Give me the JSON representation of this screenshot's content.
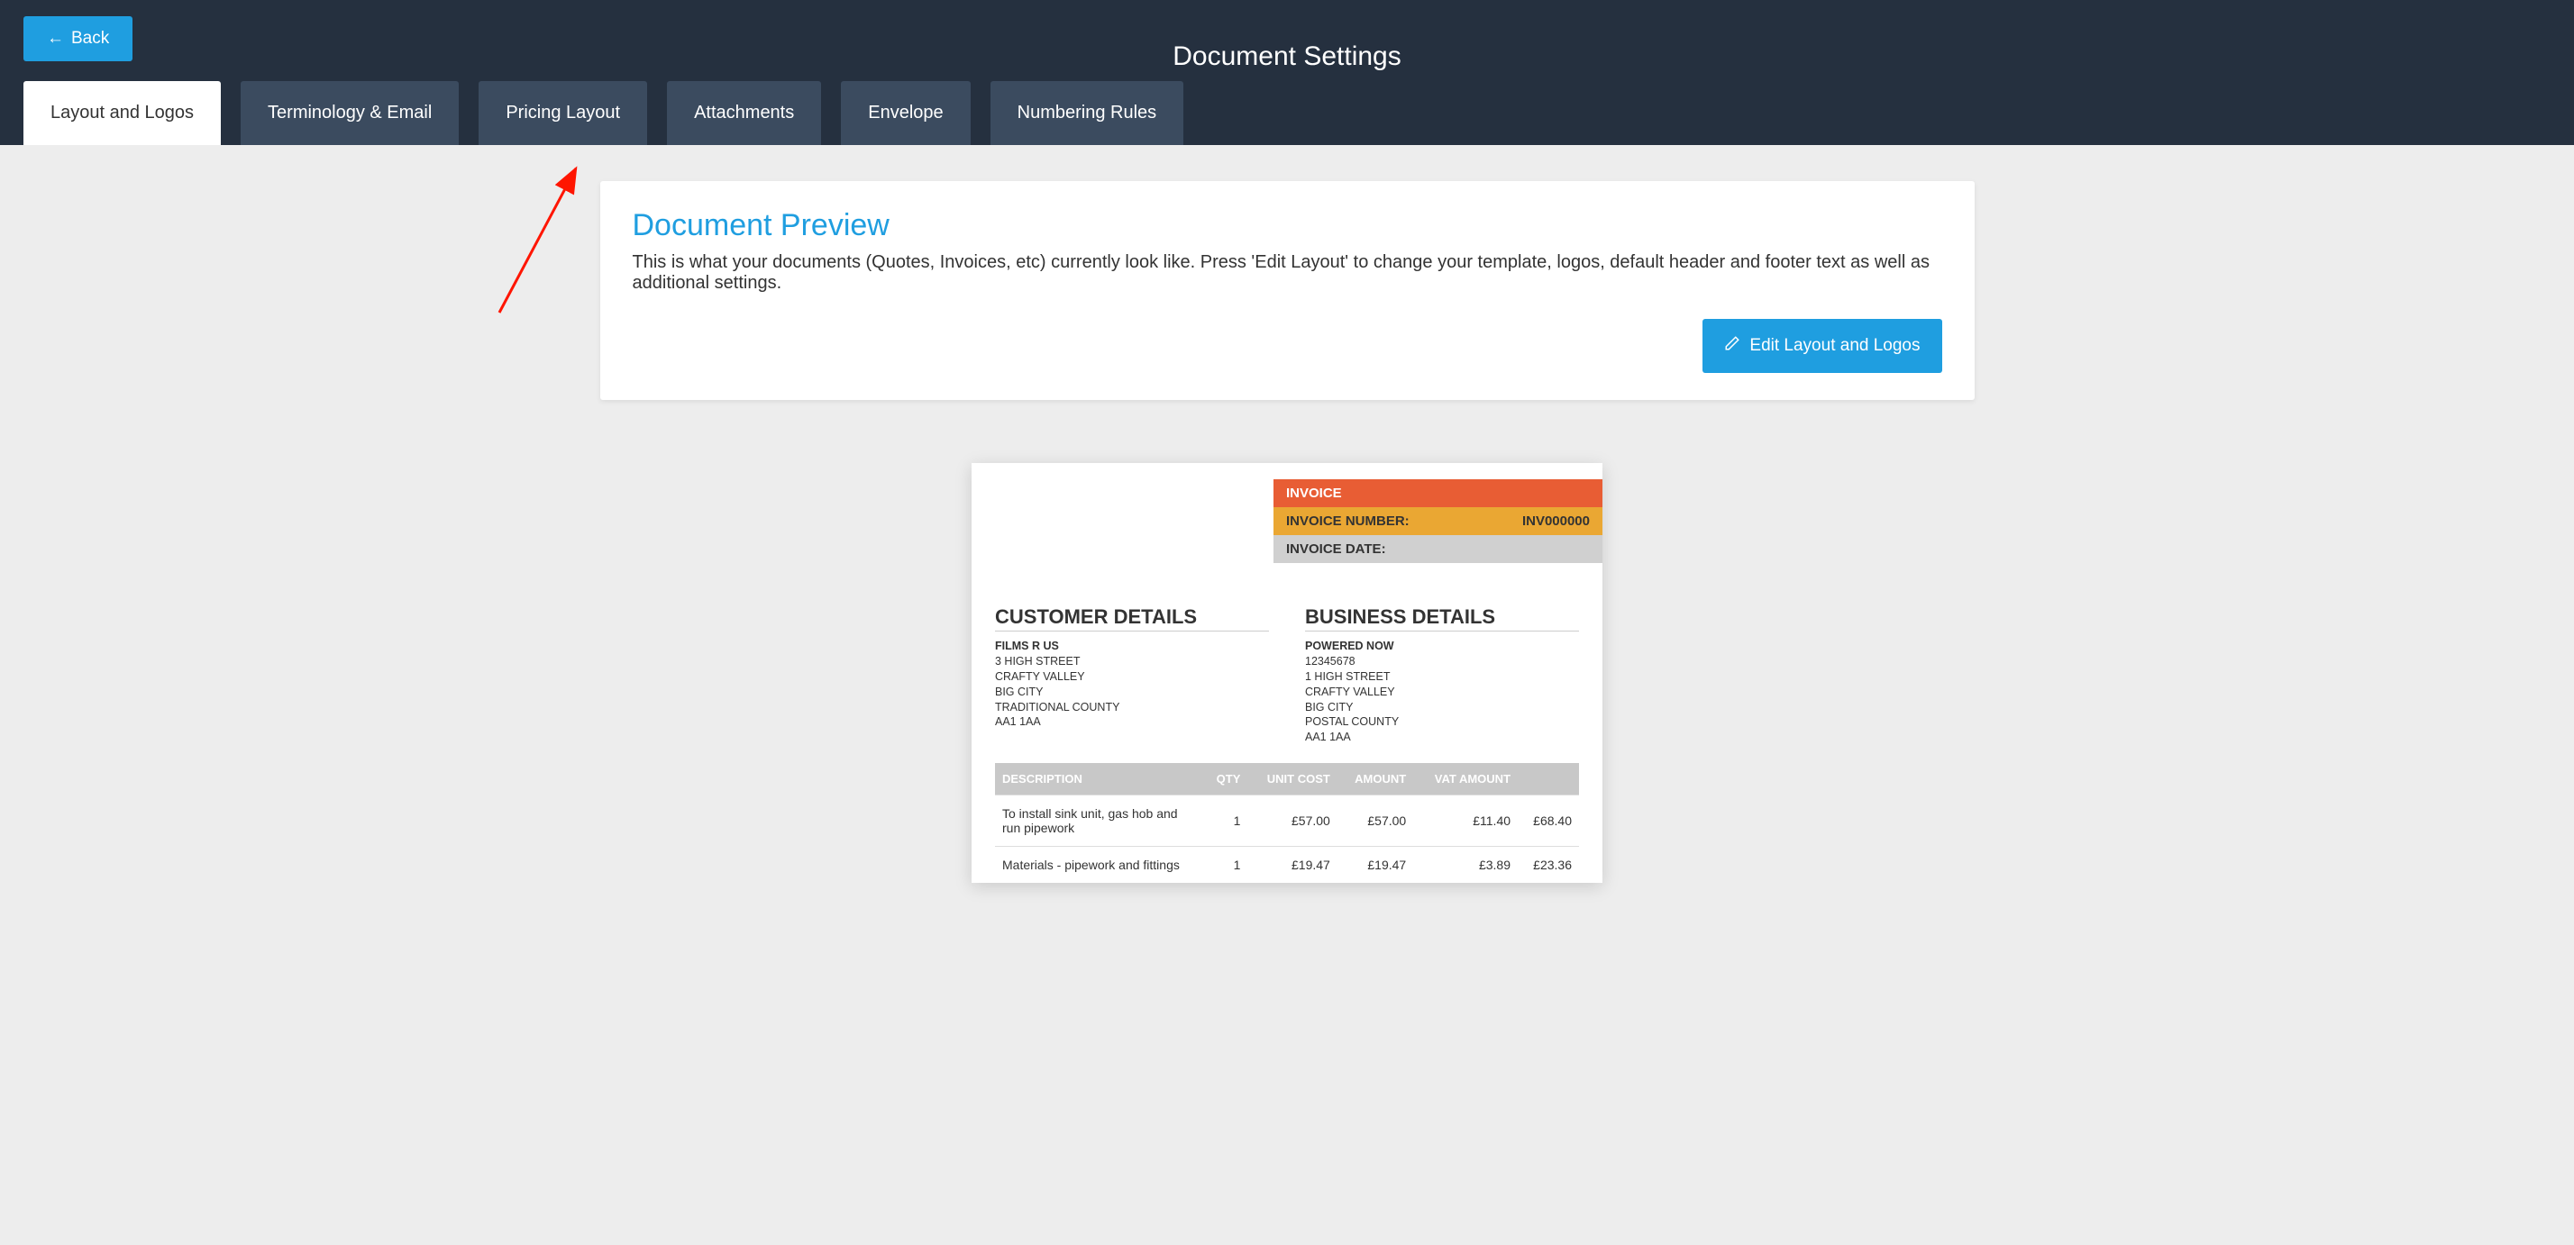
{
  "header": {
    "back_label": "Back",
    "title": "Document Settings"
  },
  "tabs": [
    {
      "label": "Layout and Logos",
      "active": true
    },
    {
      "label": "Terminology & Email",
      "active": false
    },
    {
      "label": "Pricing Layout",
      "active": false
    },
    {
      "label": "Attachments",
      "active": false
    },
    {
      "label": "Envelope",
      "active": false
    },
    {
      "label": "Numbering Rules",
      "active": false
    }
  ],
  "preview": {
    "heading": "Document Preview",
    "description": "This is what your documents (Quotes, Invoices, etc) currently look like. Press 'Edit Layout' to change your template, logos, default header and footer text as well as additional settings.",
    "edit_button": "Edit Layout and Logos"
  },
  "doc_preview": {
    "invoice_label": "INVOICE",
    "invoice_number_label": "INVOICE NUMBER:",
    "invoice_number_value": "INV000000",
    "invoice_date_label": "INVOICE DATE:",
    "customer_heading": "CUSTOMER DETAILS",
    "customer": {
      "name": "FILMS R US",
      "line1": "3 HIGH STREET",
      "line2": "CRAFTY VALLEY",
      "line3": "BIG CITY",
      "line4": "TRADITIONAL COUNTY",
      "line5": "AA1 1AA"
    },
    "business_heading": "BUSINESS DETAILS",
    "business": {
      "name": "POWERED NOW",
      "line1": "12345678",
      "line2": "1 HIGH STREET",
      "line3": "CRAFTY VALLEY",
      "line4": "BIG CITY",
      "line5": "POSTAL COUNTY",
      "line6": "AA1 1AA"
    },
    "columns": {
      "description": "DESCRIPTION",
      "qty": "QTY",
      "unit_cost": "UNIT COST",
      "amount": "AMOUNT",
      "vat_amount": "VAT AMOUNT",
      "total_blank": ""
    },
    "rows": [
      {
        "desc": "To install sink unit, gas hob and run pipework",
        "qty": "1",
        "unit": "£57.00",
        "amount": "£57.00",
        "vat": "£11.40",
        "total": "£68.40"
      },
      {
        "desc": "Materials - pipework and fittings",
        "qty": "1",
        "unit": "£19.47",
        "amount": "£19.47",
        "vat": "£3.89",
        "total": "£23.36"
      }
    ]
  }
}
